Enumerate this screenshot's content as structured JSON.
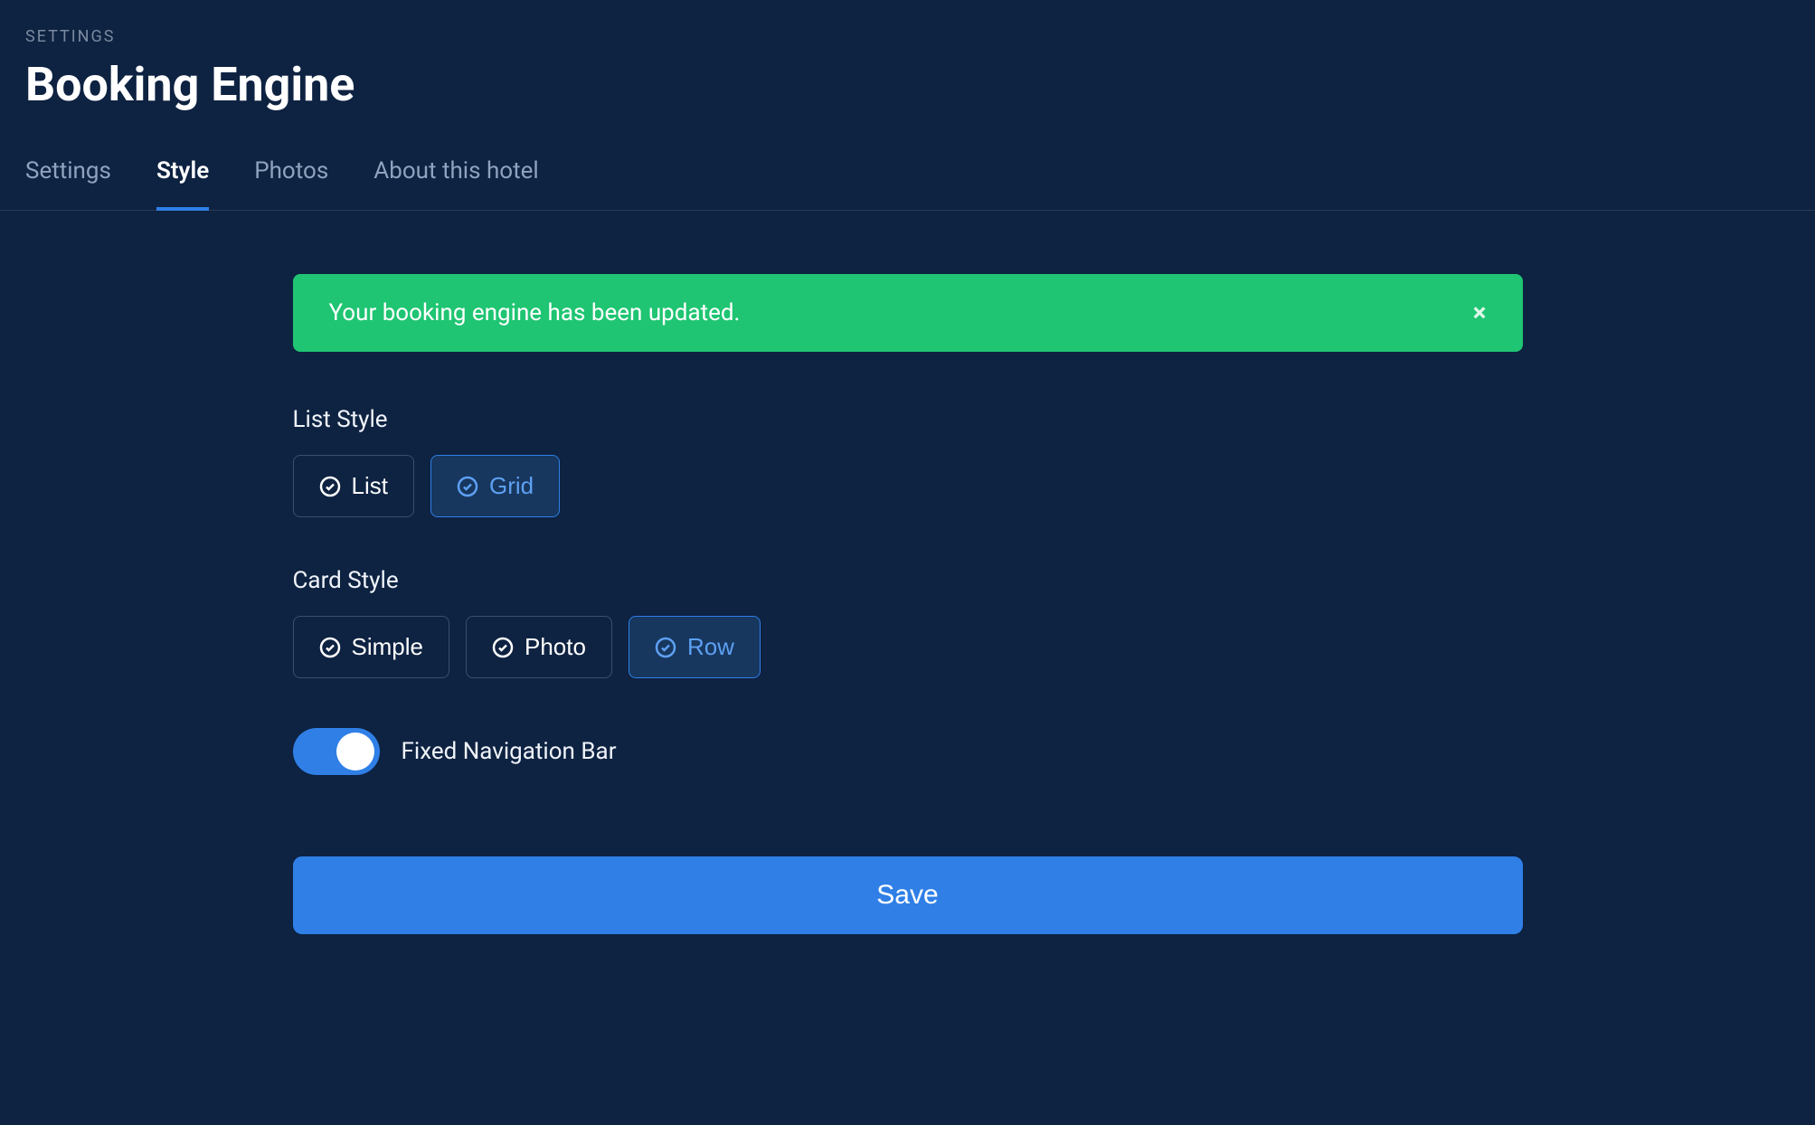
{
  "header": {
    "breadcrumb": "SETTINGS",
    "title": "Booking Engine"
  },
  "tabs": [
    {
      "label": "Settings",
      "active": false
    },
    {
      "label": "Style",
      "active": true
    },
    {
      "label": "Photos",
      "active": false
    },
    {
      "label": "About this hotel",
      "active": false
    }
  ],
  "alert": {
    "message": "Your booking engine has been updated.",
    "close_glyph": "×"
  },
  "list_style": {
    "label": "List Style",
    "options": [
      {
        "label": "List",
        "selected": false
      },
      {
        "label": "Grid",
        "selected": true
      }
    ]
  },
  "card_style": {
    "label": "Card Style",
    "options": [
      {
        "label": "Simple",
        "selected": false
      },
      {
        "label": "Photo",
        "selected": false
      },
      {
        "label": "Row",
        "selected": true
      }
    ]
  },
  "toggle": {
    "label": "Fixed Navigation Bar",
    "on": true
  },
  "save_button": "Save"
}
